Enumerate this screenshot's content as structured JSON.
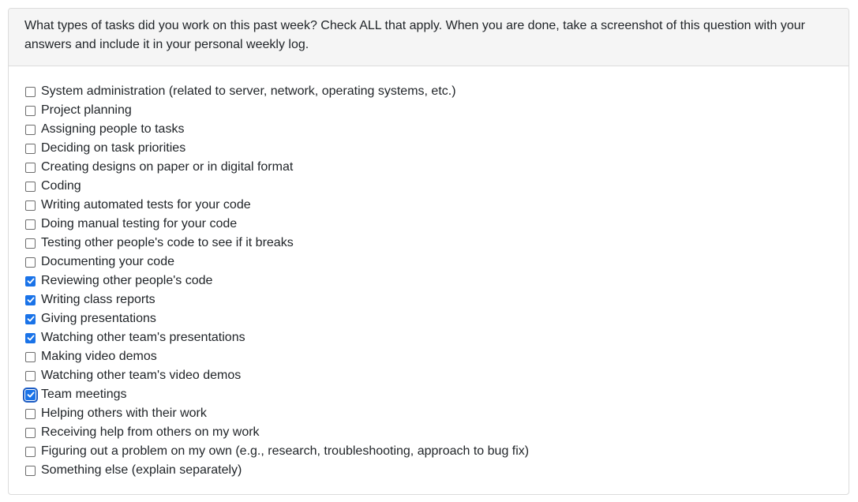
{
  "question": {
    "text": "What types of tasks did you work on this past week? Check ALL that apply. When you are done, take a screenshot of this question with your answers and include it in your personal weekly log."
  },
  "colors": {
    "checked": "#1a73e8",
    "focus_ring": "#1c5cc4"
  },
  "options": [
    {
      "label": "System administration (related to server, network, operating systems, etc.)",
      "checked": false
    },
    {
      "label": "Project planning",
      "checked": false
    },
    {
      "label": "Assigning people to tasks",
      "checked": false
    },
    {
      "label": "Deciding on task priorities",
      "checked": false
    },
    {
      "label": "Creating designs on paper or in digital format",
      "checked": false
    },
    {
      "label": "Coding",
      "checked": false
    },
    {
      "label": "Writing automated tests for your code",
      "checked": false
    },
    {
      "label": "Doing manual testing for your code",
      "checked": false
    },
    {
      "label": "Testing other people's code to see if it breaks",
      "checked": false
    },
    {
      "label": "Documenting your code",
      "checked": false
    },
    {
      "label": "Reviewing other people's code",
      "checked": true
    },
    {
      "label": "Writing class reports",
      "checked": true
    },
    {
      "label": "Giving presentations",
      "checked": true
    },
    {
      "label": "Watching other team's presentations",
      "checked": true
    },
    {
      "label": "Making video demos",
      "checked": false
    },
    {
      "label": "Watching other team's video demos",
      "checked": false
    },
    {
      "label": "Team meetings",
      "checked": true,
      "focused": true
    },
    {
      "label": "Helping others with their work",
      "checked": false
    },
    {
      "label": "Receiving help from others on my work",
      "checked": false
    },
    {
      "label": "Figuring out a problem on my own (e.g., research, troubleshooting, approach to bug fix)",
      "checked": false
    },
    {
      "label": "Something else (explain separately)",
      "checked": false
    }
  ]
}
